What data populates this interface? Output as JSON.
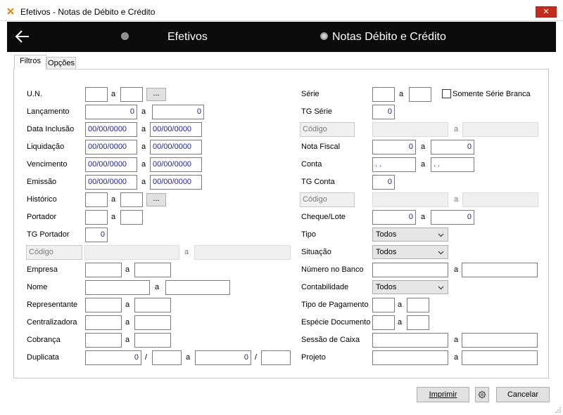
{
  "window": {
    "title": "Efetivos - Notas de Débito e Crédito",
    "close_glyph": "✕"
  },
  "header": {
    "options": [
      {
        "label": "Efetivos",
        "selected": false
      },
      {
        "label": "Notas Débito e Crédito",
        "selected": true
      }
    ]
  },
  "tabs": [
    {
      "label": "Filtros",
      "active": true
    },
    {
      "label": "Opções",
      "active": false
    }
  ],
  "separator": "a",
  "left": {
    "un_label": "U.N.",
    "lancamento_label": "Lançamento",
    "lancamento_from": "0",
    "lancamento_to": "0",
    "data_inclusao_label": "Data Inclusão",
    "data_inclusao_from": "00/00/0000",
    "data_inclusao_to": "00/00/0000",
    "liquidacao_label": "Liquidação",
    "liquidacao_from": "00/00/0000",
    "liquidacao_to": "00/00/0000",
    "vencimento_label": "Vencimento",
    "vencimento_from": "00/00/0000",
    "vencimento_to": "00/00/0000",
    "emissao_label": "Emissão",
    "emissao_from": "00/00/0000",
    "emissao_to": "00/00/0000",
    "historico_label": "Histórico",
    "portador_label": "Portador",
    "tg_portador_label": "TG Portador",
    "tg_portador_value": "0",
    "codigo_label": "Código",
    "empresa_label": "Empresa",
    "nome_label": "Nome",
    "representante_label": "Representante",
    "centralizadora_label": "Centralizadora",
    "cobranca_label": "Cobrança",
    "duplicata_label": "Duplicata",
    "duplicata_from_a": "0",
    "duplicata_to_a": "0",
    "slash": "/",
    "browse_label": "..."
  },
  "right": {
    "serie_label": "Série",
    "somente_serie_branca_label": "Somente Série Branca",
    "tg_serie_label": "TG Série",
    "tg_serie_value": "0",
    "codigo_label": "Código",
    "nota_fiscal_label": "Nota Fiscal",
    "nota_fiscal_from": "0",
    "nota_fiscal_to": "0",
    "conta_label": "Conta",
    "conta_from": ". .",
    "conta_to": ". .",
    "tg_conta_label": "TG Conta",
    "tg_conta_value": "0",
    "codigo2_label": "Código",
    "cheque_lote_label": "Cheque/Lote",
    "cheque_from": "0",
    "cheque_to": "0",
    "tipo_label": "Tipo",
    "tipo_value": "Todos",
    "situacao_label": "Situação",
    "situacao_value": "Todos",
    "numero_banco_label": "Número no Banco",
    "contabilidade_label": "Contabilidade",
    "contabilidade_value": "Todos",
    "tipo_pagamento_label": "Tipo de Pagamento",
    "especie_documento_label": "Espécie Documento",
    "sessao_caixa_label": "Sessão de Caixa",
    "projeto_label": "Projeto"
  },
  "footer": {
    "imprimir_label": "Imprimir",
    "cancelar_label": "Cancelar"
  },
  "colors": {
    "header_bg": "#0b0b0b",
    "close_red": "#c42b1c",
    "value_blue": "#1d1d8a"
  }
}
